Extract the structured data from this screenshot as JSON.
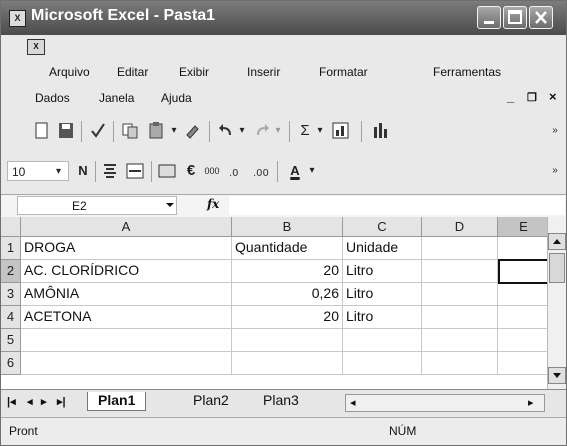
{
  "window": {
    "title": "Microsoft Excel - Pasta1",
    "app_icon": "excel-icon"
  },
  "menubar": {
    "items": [
      "Arquivo",
      "Editar",
      "Exibir",
      "Inserir",
      "Formatar",
      "Ferramentas",
      "Dados",
      "Janela",
      "Ajuda"
    ],
    "doc_controls": [
      "_",
      "❐",
      "×"
    ]
  },
  "toolbar_standard": {
    "icons": [
      "new-icon",
      "save-icon",
      "spelling-icon",
      "copy-icon",
      "paste-icon",
      "format-painter-icon",
      "undo-icon",
      "redo-icon",
      "autosum-icon",
      "chart-wizard-icon",
      "chart-icon",
      "more-icon"
    ],
    "autosum_label": "Σ"
  },
  "toolbar_format": {
    "font_size": "10",
    "bold_label": "N",
    "currency_label": "€",
    "thousands_label": "000",
    "font_color_label": "A"
  },
  "formula_bar": {
    "name_box": "E2",
    "fx_label": "fx",
    "formula": ""
  },
  "sheet": {
    "columns": [
      "A",
      "B",
      "C",
      "D",
      "E"
    ],
    "row_numbers": [
      "1",
      "2",
      "3",
      "4",
      "5",
      "6"
    ],
    "rows": [
      [
        "DROGA",
        "Quantidade",
        "Unidade",
        "",
        ""
      ],
      [
        "AC. CLORÍDRICO",
        "20",
        "Litro",
        "",
        ""
      ],
      [
        "AMÔNIA",
        "0,26",
        "Litro",
        "",
        ""
      ],
      [
        "ACETONA",
        "20",
        "Litro",
        "",
        ""
      ],
      [
        "",
        "",
        "",
        "",
        ""
      ],
      [
        "",
        "",
        "",
        "",
        ""
      ]
    ],
    "selected_cell": "E2"
  },
  "tabs": {
    "items": [
      "Plan1",
      "Plan2",
      "Plan3"
    ],
    "active": "Plan1"
  },
  "status": {
    "left": "Pront",
    "num": "NÚM"
  }
}
